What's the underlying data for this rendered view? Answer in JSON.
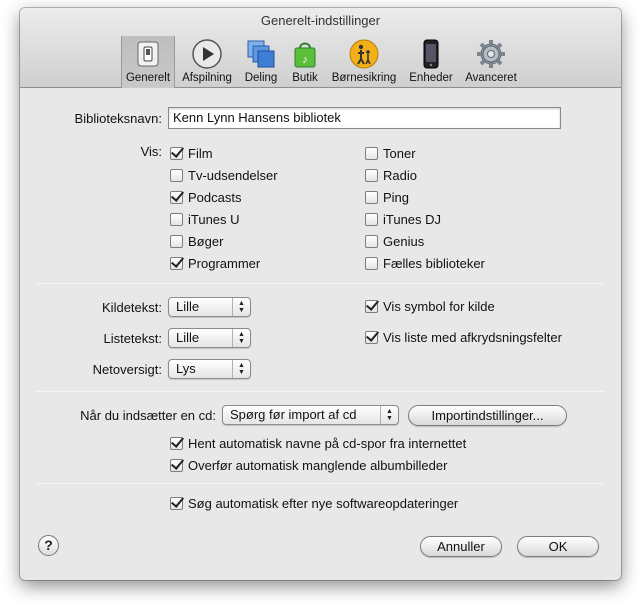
{
  "window": {
    "title": "Generelt-indstillinger"
  },
  "toolbar": {
    "items": [
      {
        "label": "Generelt",
        "icon": "switch-icon",
        "selected": true
      },
      {
        "label": "Afspilning",
        "icon": "play-icon"
      },
      {
        "label": "Deling",
        "icon": "sharing-icon"
      },
      {
        "label": "Butik",
        "icon": "store-bag-icon"
      },
      {
        "label": "Børnesikring",
        "icon": "parental-icon"
      },
      {
        "label": "Enheder",
        "icon": "iphone-icon"
      },
      {
        "label": "Avanceret",
        "icon": "gear-icon"
      }
    ]
  },
  "library": {
    "label": "Biblioteksnavn:",
    "value": "Kenn Lynn Hansens bibliotek"
  },
  "show": {
    "label": "Vis:",
    "left": [
      {
        "label": "Film",
        "checked": true
      },
      {
        "label": "Tv-udsendelser",
        "checked": false
      },
      {
        "label": "Podcasts",
        "checked": true
      },
      {
        "label": "iTunes U",
        "checked": false
      },
      {
        "label": "Bøger",
        "checked": false
      },
      {
        "label": "Programmer",
        "checked": true
      }
    ],
    "right": [
      {
        "label": "Toner",
        "checked": false
      },
      {
        "label": "Radio",
        "checked": false
      },
      {
        "label": "Ping",
        "checked": false
      },
      {
        "label": "iTunes DJ",
        "checked": false
      },
      {
        "label": "Genius",
        "checked": false
      },
      {
        "label": "Fælles biblioteker",
        "checked": false
      }
    ]
  },
  "text_sizes": {
    "source": {
      "label": "Kildetekst:",
      "value": "Lille"
    },
    "list": {
      "label": "Listetekst:",
      "value": "Lille"
    },
    "grid": {
      "label": "Netoversigt:",
      "value": "Lys"
    },
    "show_source_icon": {
      "label": "Vis symbol for kilde",
      "checked": true
    },
    "show_list_checkboxes": {
      "label": "Vis liste med afkrydsningsfelter",
      "checked": true
    }
  },
  "cd": {
    "label": "Når du indsætter en cd:",
    "value": "Spørg før import af cd",
    "import_button": "Importindstillinger...",
    "fetch_names": {
      "label": "Hent automatisk navne på cd-spor fra internettet",
      "checked": true
    },
    "fetch_artwork": {
      "label": "Overfør automatisk manglende albumbilleder",
      "checked": true
    }
  },
  "updates": {
    "label": "Søg automatisk efter nye softwareopdateringer",
    "checked": true
  },
  "footer": {
    "help": "?",
    "cancel": "Annuller",
    "ok": "OK"
  }
}
